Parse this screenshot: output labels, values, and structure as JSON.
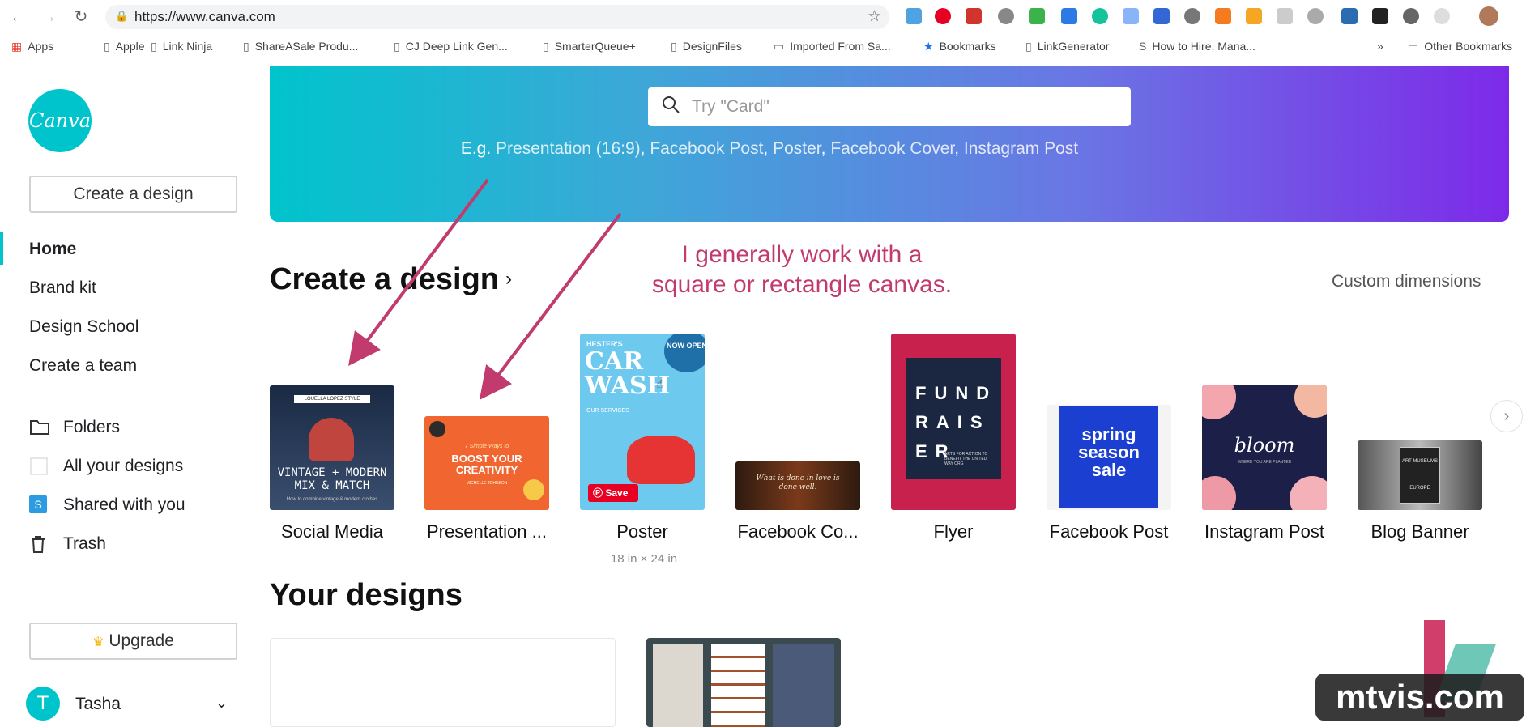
{
  "browser": {
    "url": "https://www.canva.com",
    "bookmarks": [
      {
        "label": "Apps",
        "icon": "apps-grid-icon"
      },
      {
        "label": "Apple",
        "icon": "apple-icon"
      },
      {
        "label": "Link Ninja",
        "icon": "page-icon"
      },
      {
        "label": "ShareASale Produ...",
        "icon": "page-icon"
      },
      {
        "label": "CJ Deep Link Gen...",
        "icon": "page-icon"
      },
      {
        "label": "SmarterQueue+",
        "icon": "page-icon"
      },
      {
        "label": "DesignFiles",
        "icon": "page-icon"
      },
      {
        "label": "Imported From Sa...",
        "icon": "folder-icon"
      },
      {
        "label": "Bookmarks",
        "icon": "star-icon"
      },
      {
        "label": "LinkGenerator",
        "icon": "page-icon"
      },
      {
        "label": "How to Hire, Mana...",
        "icon": "s-icon"
      }
    ],
    "other_bookmarks": "Other Bookmarks",
    "overflow": "»"
  },
  "sidebar": {
    "logo_text": "Canva",
    "create_button": "Create a design",
    "nav": [
      "Home",
      "Brand kit",
      "Design School",
      "Create a team"
    ],
    "folders": [
      {
        "label": "Folders",
        "icon": "folder-icon"
      },
      {
        "label": "All your designs",
        "icon": "square-icon"
      },
      {
        "label": "Shared with you",
        "icon": "shared-icon",
        "badge": "S"
      },
      {
        "label": "Trash",
        "icon": "trash-icon"
      }
    ],
    "upgrade": "Upgrade",
    "user": {
      "initial": "T",
      "name": "Tasha"
    }
  },
  "hero": {
    "search_placeholder": "Try \"Card\"",
    "examples_prefix": "E.g.",
    "examples": [
      "Presentation (16:9)",
      "Facebook Post",
      "Poster",
      "Facebook Cover",
      "Instagram Post"
    ]
  },
  "main": {
    "create_title": "Create a design",
    "create_chev": "›",
    "custom_dimensions": "Custom dimensions",
    "annotation_line1": "I generally work with a",
    "annotation_line2": "square or rectangle canvas.",
    "poster_dimension": "18 in × 24 in",
    "your_designs": "Your designs"
  },
  "templates": [
    {
      "label": "Social Media",
      "art_top": "LOUELLA LOPEZ STYLE",
      "art_main": "VINTAGE + MODERN MIX & MATCH",
      "art_sub": "How to combine vintage & modern clothes"
    },
    {
      "label": "Presentation ...",
      "art_top": "7 Simple Ways to",
      "art_main": "BOOST YOUR CREATIVITY",
      "art_sub": "MICHELLE JOHNSON"
    },
    {
      "label": "Poster",
      "art_top": "HESTER'S",
      "art_main": "CAR WASH",
      "art_badge": "NOW OPEN",
      "art_sub": "OUR SERVICES",
      "save": "Save"
    },
    {
      "label": "Facebook Co...",
      "art_main": "What is done in love is done well."
    },
    {
      "label": "Flyer",
      "art_main": "FUND RAIS ER",
      "art_sub": "ARTS FOR ACTION TO BENEFIT THE UNITED WAY ORG"
    },
    {
      "label": "Facebook Post",
      "art_main": "spring season sale"
    },
    {
      "label": "Instagram Post",
      "art_main": "bloom",
      "art_sub": "WHERE YOU ARE PLANTED"
    },
    {
      "label": "Blog Banner",
      "art_main": "ART MUSEUMS",
      "art_sub": "EUROPE"
    }
  ],
  "watermark": "mtvis.com",
  "colors": {
    "brand": "#00c4cc",
    "purple": "#7d2ae8",
    "annotation": "#c13b6e"
  }
}
